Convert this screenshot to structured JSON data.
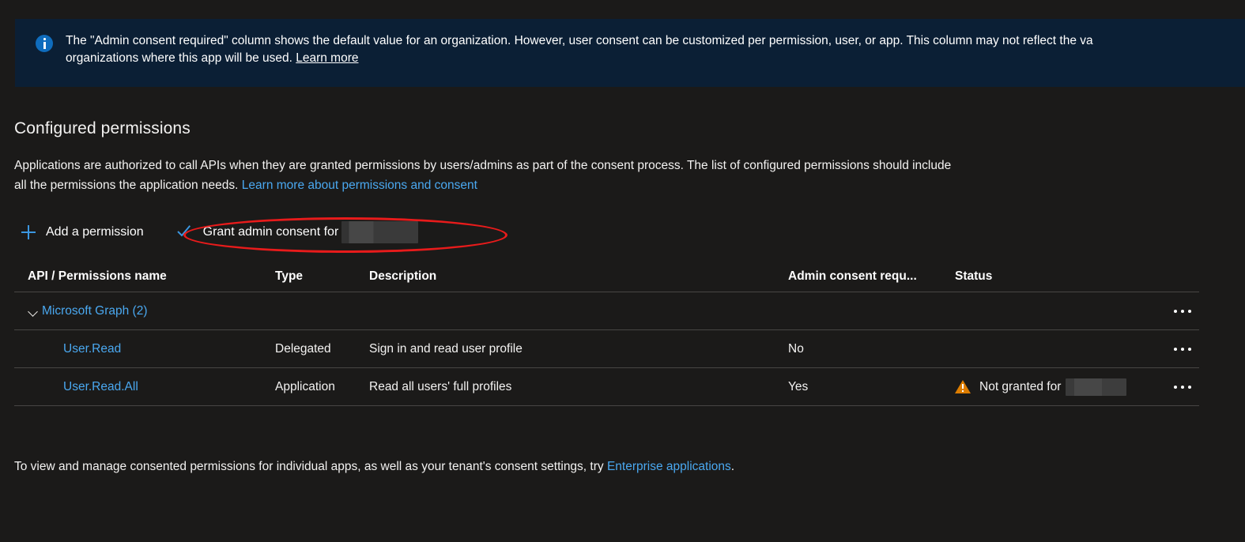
{
  "banner": {
    "icon": "info-circle-icon",
    "text_line1": "The \"Admin consent required\" column shows the default value for an organization. However, user consent can be customized per permission, user, or app. This column may not reflect the va",
    "text_line2": "organizations where this app will be used.",
    "link_label": "Learn more",
    "background_color": "#0b1f35"
  },
  "section": {
    "title": "Configured permissions",
    "description_line1": "Applications are authorized to call APIs when they are granted permissions by users/admins as part of the consent process. The list of configured permissions should include",
    "description_line2": "all the permissions the application needs.",
    "description_link": "Learn more about permissions and consent"
  },
  "commandbar": {
    "add_permission_label": "Add a permission",
    "add_permission_icon": "plus-icon",
    "grant_consent_label": "Grant admin consent for",
    "grant_consent_icon": "checkmark-icon",
    "grant_consent_tenant": "",
    "annotation_color": "#e81b1b"
  },
  "table": {
    "columns": [
      "API / Permissions name",
      "Type",
      "Description",
      "Admin consent requ...",
      "Status"
    ],
    "group": {
      "name": "Microsoft Graph (2)",
      "expand_icon": "chevron-down-icon",
      "menu_icon": "ellipsis-icon"
    },
    "rows": [
      {
        "name": "User.Read",
        "type": "Delegated",
        "description": "Sign in and read user profile",
        "admin_consent_required": "No",
        "status": "",
        "status_icon": "",
        "menu_icon": "ellipsis-icon"
      },
      {
        "name": "User.Read.All",
        "type": "Application",
        "description": "Read all users' full profiles",
        "admin_consent_required": "Yes",
        "status": "Not granted for",
        "status_icon": "warning-triangle-icon",
        "menu_icon": "ellipsis-icon"
      }
    ]
  },
  "footer": {
    "text_before": "To view and manage consented permissions for individual apps, as well as your tenant's consent settings, try",
    "link_label": "Enterprise applications",
    "text_after": "."
  },
  "colors": {
    "page_background": "#1b1a19",
    "link": "#4aa8f0",
    "accent_blue": "#3b96e0",
    "warning_orange": "#dd7d00",
    "annotation_red": "#e81b1b"
  }
}
